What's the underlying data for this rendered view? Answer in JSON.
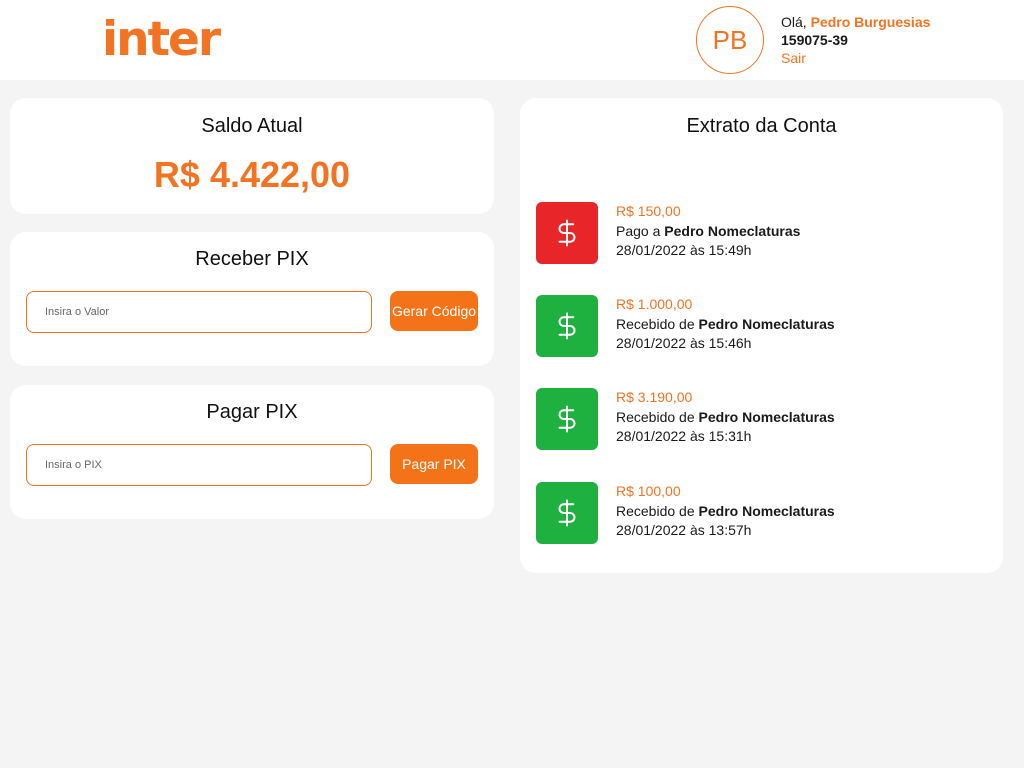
{
  "header": {
    "logo": "inter",
    "avatar_initials": "PB",
    "greeting": "Olá,",
    "user_name": "Pedro Burguesias",
    "account_number": "159075-39",
    "logout_label": "Sair"
  },
  "balance": {
    "title": "Saldo Atual",
    "value": "R$ 4.422,00"
  },
  "receive_pix": {
    "title": "Receber PIX",
    "input_placeholder": "Insira o Valor",
    "button_label": "Gerar Código"
  },
  "pay_pix": {
    "title": "Pagar PIX",
    "input_placeholder": "Insira o PIX",
    "button_label": "Pagar PIX"
  },
  "statement": {
    "title": "Extrato da Conta",
    "transactions": [
      {
        "amount": "R$ 150,00",
        "direction": "Pago a",
        "counterparty": "Pedro Nomeclaturas",
        "date": "28/01/2022 às 15:49h",
        "icon": "dollar-icon",
        "color": "#e8262a"
      },
      {
        "amount": "R$ 1.000,00",
        "direction": "Recebido de",
        "counterparty": "Pedro Nomeclaturas",
        "date": "28/01/2022 às 15:46h",
        "icon": "dollar-icon",
        "color": "#1eb140"
      },
      {
        "amount": "R$ 3.190,00",
        "direction": "Recebido de",
        "counterparty": "Pedro Nomeclaturas",
        "date": "28/01/2022 às 15:31h",
        "icon": "dollar-icon",
        "color": "#1eb140"
      },
      {
        "amount": "R$ 100,00",
        "direction": "Recebido de",
        "counterparty": "Pedro Nomeclaturas",
        "date": "28/01/2022 às 13:57h",
        "icon": "dollar-icon",
        "color": "#1eb140"
      }
    ]
  },
  "colors": {
    "brand_orange": "#f27321",
    "button_orange": "#f57318",
    "debit_red": "#e8262a",
    "credit_green": "#1eb140",
    "background": "#f4f4f4"
  }
}
